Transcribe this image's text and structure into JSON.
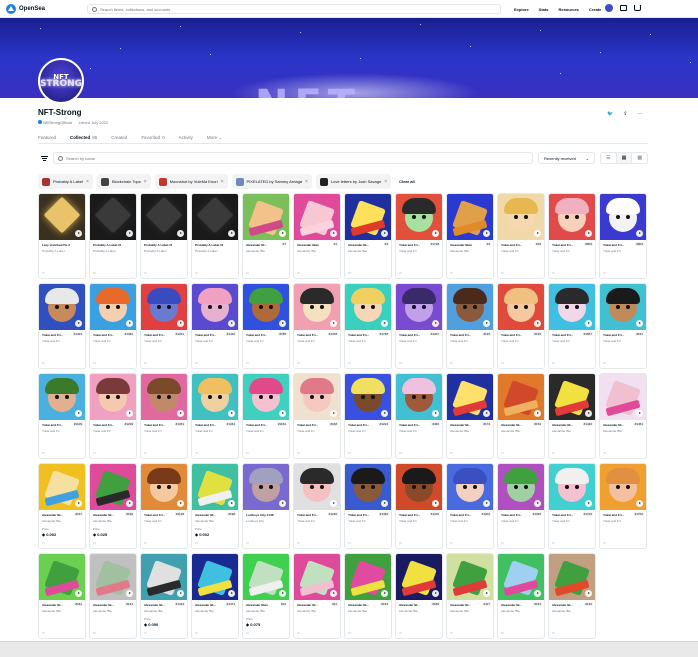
{
  "header": {
    "brand": "OpenSea",
    "search_placeholder": "Search items, collections, and accounts",
    "nav": [
      "Explore",
      "Stats",
      "Resources",
      "Create"
    ]
  },
  "banner": {
    "text": "NFT"
  },
  "collection": {
    "avatar_line1": "NFT",
    "avatar_line2": "STRONG",
    "title": "NFT-Strong",
    "owner": "NftStrongOfficial",
    "joined": "Joined July 2022"
  },
  "tabs": [
    {
      "label": "Featured",
      "count": ""
    },
    {
      "label": "Collected",
      "count": "86"
    },
    {
      "label": "Created",
      "count": ""
    },
    {
      "label": "Favorited",
      "count": "0"
    },
    {
      "label": "Activity",
      "count": ""
    },
    {
      "label": "More",
      "count": ""
    }
  ],
  "filters": {
    "search_placeholder": "Search by name",
    "sort": "Recently received"
  },
  "chips": [
    {
      "label": "Probably A Label",
      "color": "#a83232"
    },
    {
      "label": "Blockchain Tops",
      "color": "#444444"
    },
    {
      "label": "Moonshot by VuleMa Enori",
      "color": "#c0392b"
    },
    {
      "label": "PIXELATED by Sammy Arriaga",
      "color": "#6d8bbf"
    },
    {
      "label": "Love letters by Josh Savage",
      "color": "#222222"
    }
  ],
  "clear_all": "Clear all",
  "cards": [
    {
      "t1": "Lazy sketched Pu Jacket",
      "t2": "Probably A Label",
      "rank": "",
      "price_label": "",
      "price": "",
      "bg": "#3a3020",
      "hair": "#d4a84a",
      "face": "#e8c36a",
      "type": "dark"
    },
    {
      "t1": "Probably A Label #1321",
      "t2": "Probably A Label",
      "rank": "",
      "price_label": "",
      "price": "",
      "bg": "#1a1a1a",
      "hair": "#2e2e2e",
      "face": "#3a3a3a",
      "type": "dark"
    },
    {
      "t1": "Probably A Label #1716",
      "t2": "Probably A Label",
      "rank": "",
      "price_label": "",
      "price": "",
      "bg": "#1a1a1a",
      "hair": "#2e2e2e",
      "face": "#3a3a3a",
      "type": "dark"
    },
    {
      "t1": "Probably A Label #1768",
      "t2": "Probably A Label",
      "rank": "",
      "price_label": "",
      "price": "",
      "bg": "#1a1a1a",
      "hair": "#2e2e2e",
      "face": "#3a3a3a",
      "type": "dark"
    },
    {
      "t1": "Alexander Bl...",
      "t2": "Alexander Bla",
      "rank": "#7",
      "price_label": "",
      "price": "",
      "bg": "#7bbf5a",
      "hair": "#d04a8a",
      "face": "#f3c28a",
      "type": "art"
    },
    {
      "t1": "Alexander Blan",
      "t2": "Alexander Bla",
      "rank": "#1",
      "price_label": "",
      "price": "",
      "bg": "#e04a9a",
      "hair": "#ffd2e0",
      "face": "#f7c8d4",
      "type": "art"
    },
    {
      "t1": "Alexander Bl...",
      "t2": "Alexander Bla",
      "rank": "#3",
      "price_label": "",
      "price": "",
      "bg": "#1f2fa0",
      "hair": "#e03a2a",
      "face": "#ffe05a",
      "type": "art"
    },
    {
      "t1": "Yokai and Fri...",
      "t2": "Yokai and Fri",
      "rank": "#1718",
      "price_label": "",
      "price": "",
      "bg": "#e0503a",
      "hair": "#2a2a2a",
      "face": "#a8e0a0",
      "type": "face"
    },
    {
      "t1": "Alexander Blan",
      "t2": "Alexander Bla",
      "rank": "#4",
      "price_label": "",
      "price": "",
      "bg": "#2a3ad0",
      "hair": "#e08a2a",
      "face": "#e0a04a",
      "type": "art"
    },
    {
      "t1": "Yokai and Fri...",
      "t2": "Yokai and Fri",
      "rank": "#15",
      "price_label": "",
      "price": "",
      "bg": "#f0d8a8",
      "hair": "#e8b850",
      "face": "#f5d7b0",
      "type": "face"
    },
    {
      "t1": "Yokai and Fri...",
      "t2": "Yokai and Fri",
      "rank": "#804",
      "price_label": "",
      "price": "",
      "bg": "#e04a4a",
      "hair": "#f0b0c0",
      "face": "#f6d0b8",
      "type": "face"
    },
    {
      "t1": "Yokai and Fri...",
      "t2": "Yokai and Fri",
      "rank": "#804",
      "price_label": "",
      "price": "",
      "bg": "#3a3ad0",
      "hair": "#ffffff",
      "face": "#f2f2f2",
      "type": "face"
    },
    {
      "t1": "Yokai and Fri...",
      "t2": "Yokai and Fri",
      "rank": "#1423",
      "price_label": "",
      "price": "",
      "bg": "#3050c0",
      "hair": "#e8e8e8",
      "face": "#c88a5a",
      "type": "face"
    },
    {
      "t1": "Yokai and Fri...",
      "t2": "Yokai and Fri",
      "rank": "#1392",
      "price_label": "",
      "price": "",
      "bg": "#3aa0e0",
      "hair": "#e86a2a",
      "face": "#f5d0b0",
      "type": "face"
    },
    {
      "t1": "Yokai and Fri...",
      "t2": "Yokai and Fri",
      "rank": "#1231",
      "price_label": "",
      "price": "",
      "bg": "#e04040",
      "hair": "#3a4ac0",
      "face": "#6a7ad0",
      "type": "face"
    },
    {
      "t1": "Yokai and Fri...",
      "t2": "Yokai and Fri",
      "rank": "#1410",
      "price_label": "",
      "price": "",
      "bg": "#5a4ad0",
      "hair": "#f0a0c0",
      "face": "#e8b0d0",
      "type": "face"
    },
    {
      "t1": "Yokai and Fri...",
      "t2": "Yokai and Fri",
      "rank": "#785",
      "price_label": "",
      "price": "",
      "bg": "#3050e0",
      "hair": "#40a040",
      "face": "#b06a3a",
      "type": "face"
    },
    {
      "t1": "Yokai and Fri...",
      "t2": "Yokai and Fri",
      "rank": "#1378",
      "price_label": "",
      "price": "",
      "bg": "#f0a0b0",
      "hair": "#2a2a2a",
      "face": "#f5e0c0",
      "type": "face"
    },
    {
      "t1": "Yokai and Fri...",
      "t2": "Yokai and Fri",
      "rank": "#1748",
      "price_label": "",
      "price": "",
      "bg": "#3ad0c0",
      "hair": "#f0d060",
      "face": "#f5d7b8",
      "type": "face"
    },
    {
      "t1": "Yokai and Fri...",
      "t2": "Yokai and Fri",
      "rank": "#1207",
      "price_label": "",
      "price": "",
      "bg": "#7a4ad0",
      "hair": "#3a2a6a",
      "face": "#c0a0e8",
      "type": "face"
    },
    {
      "t1": "Yokai and Fri...",
      "t2": "Yokai and Fri",
      "rank": "#135",
      "price_label": "",
      "price": "",
      "bg": "#50a0e0",
      "hair": "#4a2a1a",
      "face": "#8a5a3a",
      "type": "face"
    },
    {
      "t1": "Yokai and Fri...",
      "t2": "Yokai and Fri",
      "rank": "#135",
      "price_label": "",
      "price": "",
      "bg": "#e04a3a",
      "hair": "#f0c080",
      "face": "#f5c8a0",
      "type": "face"
    },
    {
      "t1": "Yokai and Fri...",
      "t2": "Yokai and Fri",
      "rank": "#1567",
      "price_label": "",
      "price": "",
      "bg": "#40c0e0",
      "hair": "#2a2a2a",
      "face": "#f0d8e8",
      "type": "face"
    },
    {
      "t1": "Yokai and Fri...",
      "t2": "Yokai and Fri",
      "rank": "#151",
      "price_label": "",
      "price": "",
      "bg": "#40c0d0",
      "hair": "#1a1a1a",
      "face": "#c08a5a",
      "type": "face"
    },
    {
      "t1": "Yokai and Fri...",
      "t2": "Yokai and Fri",
      "rank": "#1109",
      "price_label": "",
      "price": "",
      "bg": "#4ab0e0",
      "hair": "#3a7a2a",
      "face": "#e0b090",
      "type": "face"
    },
    {
      "t1": "Yokai and Fri...",
      "t2": "Yokai and Fri",
      "rank": "#1299",
      "price_label": "",
      "price": "",
      "bg": "#f0a0c0",
      "hair": "#7a3a3a",
      "face": "#f5c8b0",
      "type": "face"
    },
    {
      "t1": "Yokai and Fri...",
      "t2": "Yokai and Fri",
      "rank": "#1361",
      "price_label": "",
      "price": "",
      "bg": "#e06aa0",
      "hair": "#7a4a2a",
      "face": "#c08a6a",
      "type": "face"
    },
    {
      "t1": "Yokai and Fri...",
      "t2": "Yokai and Fri",
      "rank": "#1344",
      "price_label": "",
      "price": "",
      "bg": "#40c0c0",
      "hair": "#f0c060",
      "face": "#f0d0a0",
      "type": "face"
    },
    {
      "t1": "Yokai and Fri...",
      "t2": "Yokai and Fri",
      "rank": "#1152",
      "price_label": "",
      "price": "",
      "bg": "#40d0c0",
      "hair": "#e04a8a",
      "face": "#f5c0d0",
      "type": "face"
    },
    {
      "t1": "Yokai and Fri...",
      "t2": "Yokai and Fri",
      "rank": "#168",
      "price_label": "",
      "price": "",
      "bg": "#f0e0d0",
      "hair": "#e07a8a",
      "face": "#f6c8c0",
      "type": "face"
    },
    {
      "t1": "Yokai and Fri...",
      "t2": "Yokai and Fri",
      "rank": "#1224",
      "price_label": "",
      "price": "",
      "bg": "#3a50e0",
      "hair": "#f0e060",
      "face": "#7a4a2a",
      "type": "face"
    },
    {
      "t1": "Yokai and Fri...",
      "t2": "Yokai and Fri",
      "rank": "#466",
      "price_label": "",
      "price": "",
      "bg": "#40c0d0",
      "hair": "#f0c0e0",
      "face": "#a05a3a",
      "type": "face"
    },
    {
      "t1": "Alexander Bl...",
      "t2": "Alexander Bla",
      "rank": "#174",
      "price_label": "",
      "price": "",
      "bg": "#2030a0",
      "hair": "#e03a3a",
      "face": "#ffe06a",
      "type": "art"
    },
    {
      "t1": "Alexander Bl...",
      "t2": "Alexander Bla",
      "rank": "#154",
      "price_label": "",
      "price": "",
      "bg": "#e07a2a",
      "hair": "#f0b060",
      "face": "#d04a2a",
      "type": "art"
    },
    {
      "t1": "Alexander Bl...",
      "t2": "Alexander Bla",
      "rank": "#1446",
      "price_label": "",
      "price": "",
      "bg": "#2a2a2a",
      "hair": "#e03a3a",
      "face": "#f0e040",
      "type": "art"
    },
    {
      "t1": "Alexander Bl...",
      "t2": "Alexander Bla",
      "rank": "#1461",
      "price_label": "",
      "price": "",
      "bg": "#f0e0f0",
      "hair": "#e04a9a",
      "face": "#f0c0d0",
      "type": "art"
    },
    {
      "t1": "Alexander Bl...",
      "t2": "Alexander Bla",
      "rank": "#197",
      "price_label": "Price",
      "price": "0.002",
      "bg": "#f0c020",
      "hair": "#40a0e0",
      "face": "#f5e0a0",
      "type": "art"
    },
    {
      "t1": "Alexander Bl...",
      "t2": "Alexander Bla",
      "rank": "#190",
      "price_label": "Price",
      "price": "0.025",
      "bg": "#e04a9a",
      "hair": "#2a2a2a",
      "face": "#40a040",
      "type": "art"
    },
    {
      "t1": "Yokai and Fri...",
      "t2": "Yokai and Fri",
      "rank": "#1128",
      "price_label": "",
      "price": "",
      "bg": "#e08a3a",
      "hair": "#7a3a1a",
      "face": "#f5c8a0",
      "type": "face"
    },
    {
      "t1": "Alexander Bl...",
      "t2": "Alexander Bla",
      "rank": "#198",
      "price_label": "Price",
      "price": "0.002",
      "bg": "#40c0a0",
      "hair": "#f0f0f0",
      "face": "#e0e040",
      "type": "art"
    },
    {
      "t1": "Lostboys City #1423",
      "t2": "Lostboys City",
      "rank": "",
      "price_label": "",
      "price": "",
      "bg": "#7a6ad0",
      "hair": "#a0a0c0",
      "face": "#c0a0a0",
      "type": "face"
    },
    {
      "t1": "Yokai and Fri...",
      "t2": "Yokai and Fri",
      "rank": "#1236",
      "price_label": "",
      "price": "",
      "bg": "#e0e0e0",
      "hair": "#2a2a2a",
      "face": "#f5c0c0",
      "type": "face"
    },
    {
      "t1": "Yokai and Fri...",
      "t2": "Yokai and Fri",
      "rank": "#1492",
      "price_label": "",
      "price": "",
      "bg": "#3a5ad0",
      "hair": "#1a1a1a",
      "face": "#8a5a3a",
      "type": "face"
    },
    {
      "t1": "Yokai and Fri...",
      "t2": "Yokai and Fri",
      "rank": "#1415",
      "price_label": "",
      "price": "",
      "bg": "#d04a2a",
      "hair": "#1a1a1a",
      "face": "#8a4a2a",
      "type": "face"
    },
    {
      "t1": "Yokai and Fri...",
      "t2": "Yokai and Fri",
      "rank": "#1204",
      "price_label": "",
      "price": "",
      "bg": "#4a6ae0",
      "hair": "#3a50c0",
      "face": "#f5d0c0",
      "type": "face"
    },
    {
      "t1": "Yokai and Fri...",
      "t2": "Yokai and Fri",
      "rank": "#1346",
      "price_label": "",
      "price": "",
      "bg": "#b050c0",
      "hair": "#40a040",
      "face": "#a0d0a0",
      "type": "face"
    },
    {
      "t1": "Yokai and Fri...",
      "t2": "Yokai and Fri",
      "rank": "#1702",
      "price_label": "",
      "price": "",
      "bg": "#40d0d0",
      "hair": "#f0f0f0",
      "face": "#f5c0d0",
      "type": "face"
    },
    {
      "t1": "Yokai and Fri...",
      "t2": "Yokai and Fri",
      "rank": "#1702",
      "price_label": "",
      "price": "",
      "bg": "#f0a030",
      "hair": "#e09040",
      "face": "#f5c0a0",
      "type": "face"
    },
    {
      "t1": "Alexander Bl...",
      "t2": "Alexander Bla",
      "rank": "#181",
      "price_label": "",
      "price": "",
      "bg": "#6ad050",
      "hair": "#e04a9a",
      "face": "#40a040",
      "type": "art"
    },
    {
      "t1": "Alexander Bl...",
      "t2": "Alexander Bla",
      "rank": "#141",
      "price_label": "",
      "price": "",
      "bg": "#c0c0c0",
      "hair": "#e07a8a",
      "face": "#a0c0a0",
      "type": "art"
    },
    {
      "t1": "Alexander Bl...",
      "t2": "Alexander Bla",
      "rank": "#1424",
      "price_label": "Price",
      "price": "0.050",
      "bg": "#40a0b0",
      "hair": "#2a2a2a",
      "face": "#e0e0e0",
      "type": "art"
    },
    {
      "t1": "Alexander Bl...",
      "t2": "Alexander Bla",
      "rank": "#1471",
      "price_label": "",
      "price": "",
      "bg": "#1a2a90",
      "hair": "#f0e040",
      "face": "#40c0e0",
      "type": "art"
    },
    {
      "t1": "Alexander Blan",
      "t2": "Alexander Bla",
      "rank": "#12",
      "price_label": "Price",
      "price": "0.075",
      "bg": "#40d050",
      "hair": "#f0f0f0",
      "face": "#c0e0c0",
      "type": "art"
    },
    {
      "t1": "Alexander Bl...",
      "t2": "Alexander Bla",
      "rank": "#11",
      "price_label": "",
      "price": "",
      "bg": "#e04a9a",
      "hair": "#f0c0d0",
      "face": "#c0e0c0",
      "type": "art"
    },
    {
      "t1": "Alexander Bl...",
      "t2": "Alexander Bla",
      "rank": "#193",
      "price_label": "",
      "price": "",
      "bg": "#40a040",
      "hair": "#f0e040",
      "face": "#e04aa0",
      "type": "art"
    },
    {
      "t1": "Alexander Bl...",
      "t2": "Alexander Bla",
      "rank": "#186",
      "price_label": "",
      "price": "",
      "bg": "#1a1a60",
      "hair": "#e03a3a",
      "face": "#f0e040",
      "type": "art"
    },
    {
      "t1": "Alexander Bl...",
      "t2": "Alexander Bla",
      "rank": "#117",
      "price_label": "",
      "price": "",
      "bg": "#d0e0a0",
      "hair": "#e03a3a",
      "face": "#40a040",
      "type": "art"
    },
    {
      "t1": "Alexander Bl...",
      "t2": "Alexander Bla",
      "rank": "#154",
      "price_label": "",
      "price": "",
      "bg": "#40c060",
      "hair": "#e04a9a",
      "face": "#a0d0f0",
      "type": "art"
    },
    {
      "t1": "Alexander Bl...",
      "t2": "Alexander Bla",
      "rank": "#140",
      "price_label": "",
      "price": "",
      "bg": "#c0a080",
      "hair": "#e04a2a",
      "face": "#40a040",
      "type": "art"
    }
  ]
}
